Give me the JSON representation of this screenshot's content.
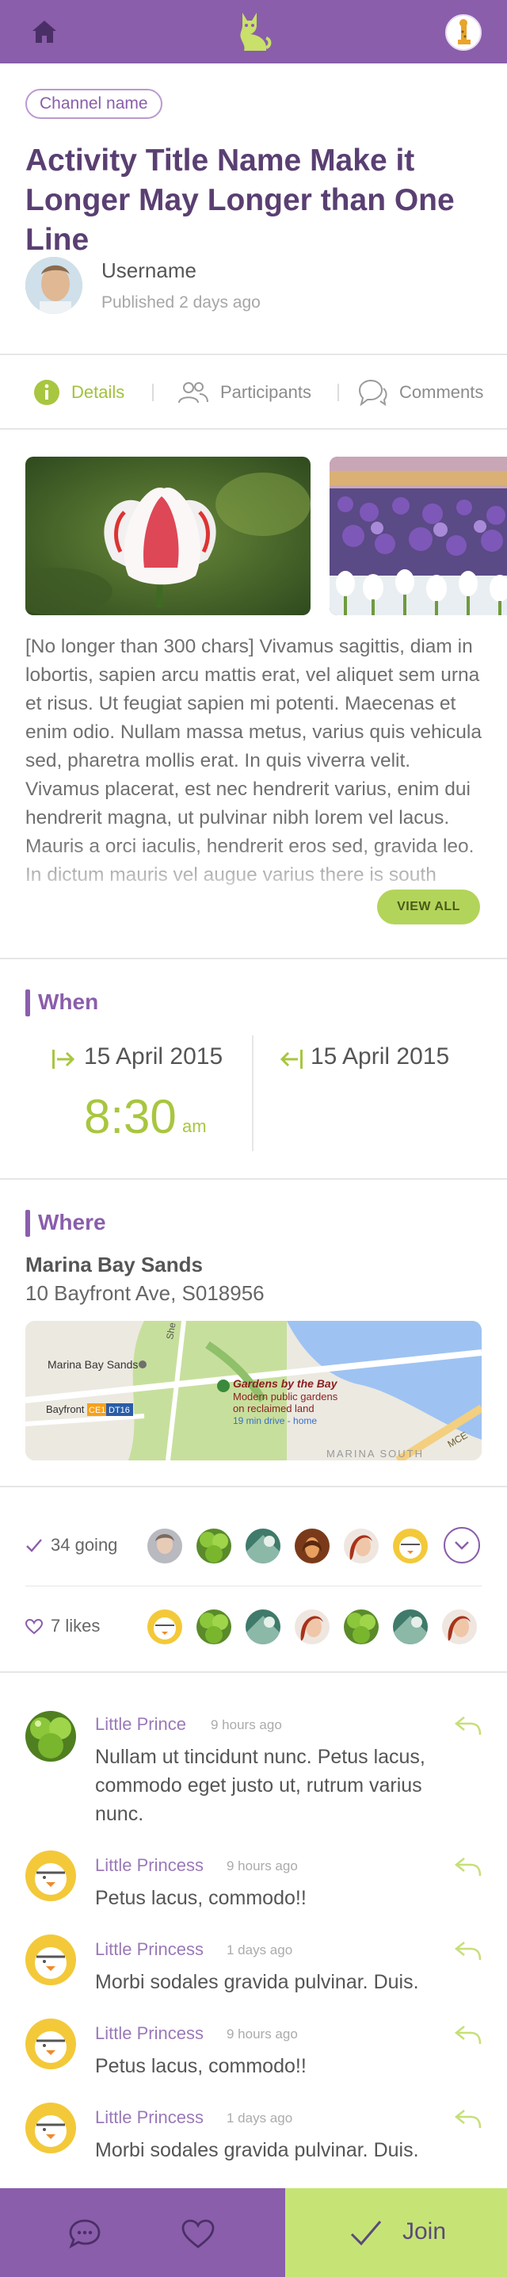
{
  "header": {
    "home_icon": "home-icon",
    "logo_icon": "cat-logo-icon",
    "avatar_icon": "giraffe-avatar-icon"
  },
  "activity": {
    "channel": "Channel name",
    "title": "Activity Title Name Make it Longer May Longer than One Line",
    "author": "Username",
    "published": "Published 2 days ago"
  },
  "tabs": [
    {
      "label": "Details",
      "icon": "info-icon",
      "active": true
    },
    {
      "label": "Participants",
      "icon": "people-icon",
      "active": false
    },
    {
      "label": "Comments",
      "icon": "chat-bubbles-icon",
      "active": false
    }
  ],
  "description": "[No longer than 300 chars] Vivamus sagittis, diam in lobortis, sapien arcu mattis erat, vel aliquet sem urna et risus. Ut feugiat sapien mi potenti. Maecenas et enim odio. Nullam massa metus, varius quis vehicula sed, pharetra mollis erat. In quis viverra velit. Vivamus placerat, est nec hendrerit varius, enim dui hendrerit magna, ut pulvinar nibh lorem vel lacus. Mauris a orci iaculis, hendrerit eros sed, gravida leo. In dictum mauris vel augue varius there is south",
  "view_all": "VIEW ALL",
  "when": {
    "heading": "When",
    "start_date": "15 April 2015",
    "end_date": "15 April 2015",
    "time": "8:30",
    "ampm": "am"
  },
  "where": {
    "heading": "Where",
    "venue": "Marina Bay Sands",
    "address": "10 Bayfront Ave, S018956",
    "map": {
      "label_marina": "Marina Bay Sands",
      "label_bayfront": "Bayfront",
      "badge_ce1": "CE1",
      "badge_dt16": "DT16",
      "poi_title": "Gardens by the Bay",
      "poi_sub1": "Modern public gardens",
      "poi_sub2": "on reclaimed land",
      "poi_dist": "19 min drive - home",
      "label_south": "MARINA SOUTH",
      "label_mce": "MCE",
      "label_she": "She"
    }
  },
  "going": {
    "label": "34 going"
  },
  "likes": {
    "label": "7 likes"
  },
  "comments": [
    {
      "name": "Little Prince",
      "time": "9 hours ago",
      "text": "Nullam ut tincidunt nunc. Petus lacus, commodo eget justo ut, rutrum varius nunc.",
      "avatar": "lime-avatar"
    },
    {
      "name": "Little Princess",
      "time": "9 hours ago",
      "text": "Petus lacus, commodo!!",
      "avatar": "bird-avatar"
    },
    {
      "name": "Little Princess",
      "time": "1 days ago",
      "text": "Morbi sodales gravida pulvinar. Duis.",
      "avatar": "bird-avatar"
    },
    {
      "name": "Little Princess",
      "time": "9 hours ago",
      "text": "Petus lacus, commodo!!",
      "avatar": "bird-avatar"
    },
    {
      "name": "Little Princess",
      "time": "1 days ago",
      "text": "Morbi sodales gravida pulvinar. Duis.",
      "avatar": "bird-avatar"
    }
  ],
  "bottom": {
    "comment_icon": "chat-icon",
    "like_icon": "heart-icon",
    "join_label": "Join"
  },
  "colors": {
    "brand_purple": "#8a5eab",
    "accent_green": "#a8c63f",
    "join_green": "#c6e475"
  }
}
